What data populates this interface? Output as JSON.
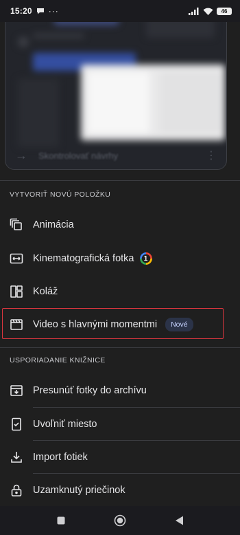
{
  "status_bar": {
    "time": "15:20",
    "battery": "46"
  },
  "sections": [
    {
      "header": "VYTVORIŤ NOVÚ POLOŽKU",
      "items": [
        {
          "label": "Animácia",
          "icon": "animation-icon"
        },
        {
          "label": "Kinematografická fotka",
          "icon": "cinematic-photo-icon",
          "badge": "1"
        },
        {
          "label": "Koláž",
          "icon": "collage-icon"
        },
        {
          "label": "Video s hlavnými momentmi",
          "icon": "highlight-video-icon",
          "badge": "Nové"
        }
      ]
    },
    {
      "header": "USPORIADANIE KNIŽNICE",
      "items": [
        {
          "label": "Presunúť fotky do archívu",
          "icon": "archive-icon"
        },
        {
          "label": "Uvoľniť miesto",
          "icon": "free-up-space-icon"
        },
        {
          "label": "Import fotiek",
          "icon": "import-icon"
        },
        {
          "label": "Uzamknutý priečinok",
          "icon": "lock-icon"
        }
      ]
    }
  ],
  "preview": {
    "footer_label": "Skontrolovať návrhy"
  },
  "colors": {
    "background": "#1f1f1f",
    "badge_new_bg": "#2b3348",
    "highlight": "#d9363e"
  }
}
